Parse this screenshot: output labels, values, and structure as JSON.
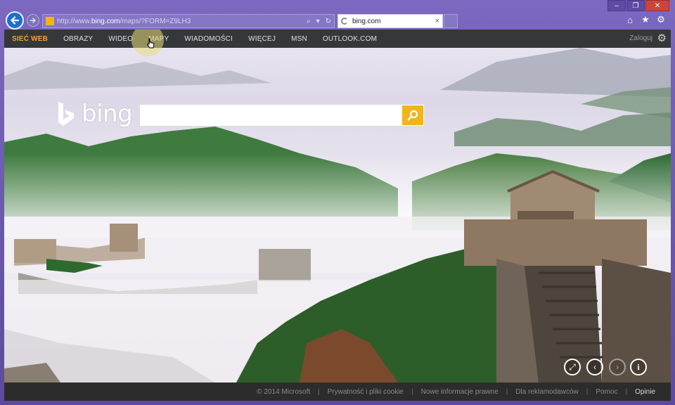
{
  "browser": {
    "url_prefix": "http://www.",
    "url_host": "bing.com",
    "url_path": "/maps/?FORM=Z9LH3",
    "tab_title": "bing.com",
    "tab_close": "×",
    "search_glyph": "⌕",
    "dropdown_glyph": "▾",
    "refresh_glyph": "↻"
  },
  "window_controls": [
    "–",
    "❐",
    "✕"
  ],
  "toolbar_icons": {
    "home": "⌂",
    "favorites": "★",
    "tools": "⚙"
  },
  "nav": {
    "items": [
      {
        "label": "SIEĆ WEB",
        "active": true
      },
      {
        "label": "OBRAZY"
      },
      {
        "label": "WIDEO"
      },
      {
        "label": "MAPY",
        "hovered": true
      },
      {
        "label": "WIADOMOŚCI"
      },
      {
        "label": "WIĘCEJ"
      },
      {
        "label": "MSN"
      },
      {
        "label": "OUTLOOK.COM"
      }
    ],
    "signin": "Zaloguj",
    "settings_icon": "⚙"
  },
  "logo": {
    "word": "bing"
  },
  "search": {
    "value": ""
  },
  "image_controls": {
    "fullscreen": "⤢",
    "prev": "‹",
    "next": "›",
    "info": "i"
  },
  "footer": {
    "items": [
      "© 2014 Microsoft",
      "Prywatność i pliki cookie",
      "Nowe informacje prawne",
      "Dla reklamodawców",
      "Pomoc",
      "Opinie"
    ]
  },
  "colors": {
    "accent_nav": "#f2a23a",
    "search_button": "#f0b51c",
    "frame": "#6a56a8"
  }
}
